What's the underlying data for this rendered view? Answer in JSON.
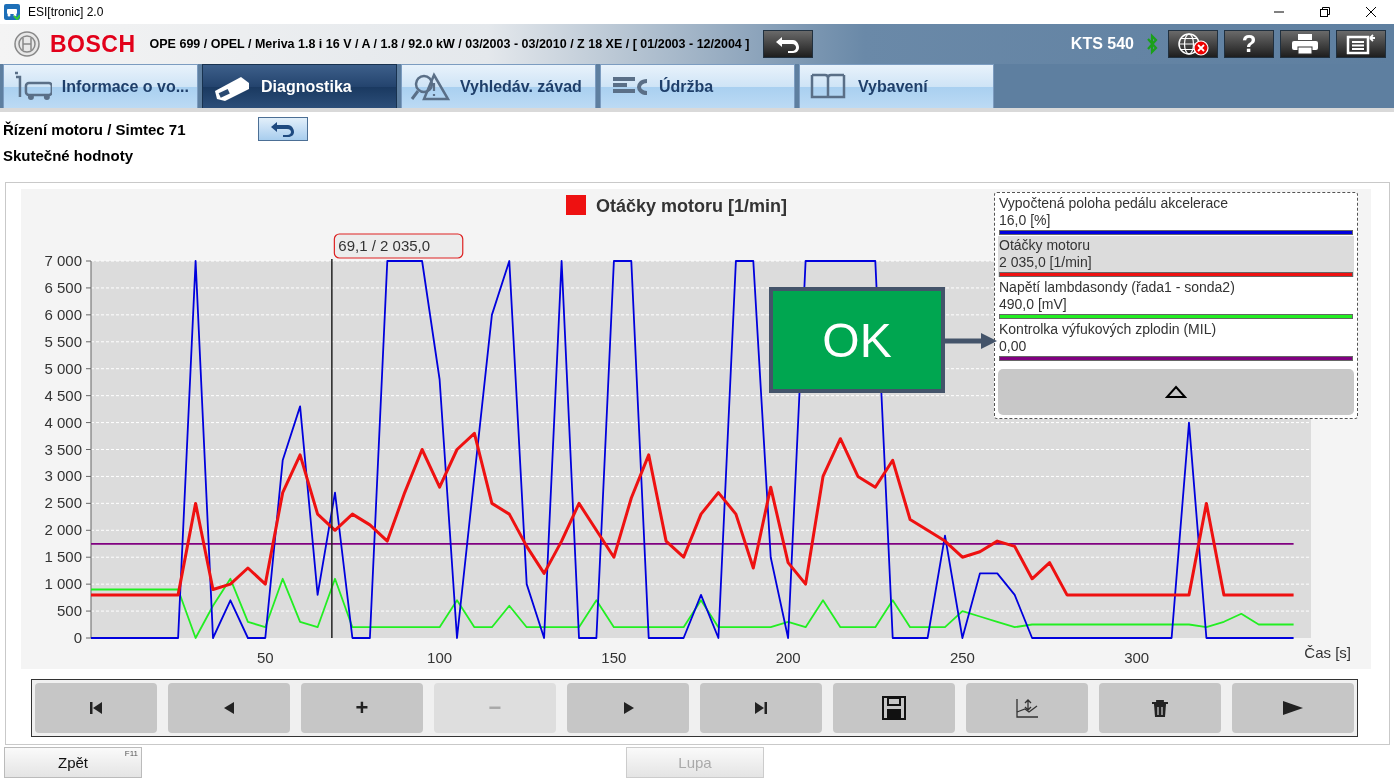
{
  "window": {
    "title": "ESI[tronic] 2.0"
  },
  "header": {
    "brand": "BOSCH",
    "vehicle": "OPE 699 / OPEL / Meriva 1.8 i 16 V / A / 1.8 / 92.0 kW / 03/2003 - 03/2010 / Z 18 XE / [ 01/2003 - 12/2004 ]",
    "device": "KTS 540",
    "help_label": "?"
  },
  "tabs": [
    {
      "label": "Informace o vo...",
      "kind": "vehicle",
      "selected": false
    },
    {
      "label": "Diagnostika",
      "kind": "diagnostics",
      "selected": true
    },
    {
      "label": "Vyhledáv. závad",
      "kind": "search",
      "selected": false
    },
    {
      "label": "Údržba",
      "kind": "service",
      "selected": false
    },
    {
      "label": "Vybavení",
      "kind": "equipment",
      "selected": false
    }
  ],
  "breadcrumb": "Řízení motoru / Simtec 71",
  "subtitle": "Skutečné hodnoty",
  "chart": {
    "chart_data": {
      "type": "line",
      "title": "Otáčky motoru [1/min]",
      "xlabel": "Čas [s]",
      "xlim": [
        0,
        350
      ],
      "ylim": [
        0,
        7000
      ],
      "xticks": [
        50,
        100,
        150,
        200,
        250,
        300
      ],
      "yticks": [
        {
          "value": 0,
          "label": "0"
        },
        {
          "value": 500,
          "label": "500"
        },
        {
          "value": 1000,
          "label": "1 000"
        },
        {
          "value": 1500,
          "label": "1 500"
        },
        {
          "value": 2000,
          "label": "2 000"
        },
        {
          "value": 2500,
          "label": "2 500"
        },
        {
          "value": 3000,
          "label": "3 000"
        },
        {
          "value": 3500,
          "label": "3 500"
        },
        {
          "value": 4000,
          "label": "4 000"
        },
        {
          "value": 4500,
          "label": "4 500"
        },
        {
          "value": 5000,
          "label": "5 000"
        },
        {
          "value": 5500,
          "label": "5 500"
        },
        {
          "value": 6000,
          "label": "6 000"
        },
        {
          "value": 6500,
          "label": "6 500"
        },
        {
          "value": 7000,
          "label": "7 000"
        }
      ],
      "x": [
        0,
        5,
        10,
        15,
        20,
        25,
        30,
        35,
        40,
        45,
        50,
        55,
        60,
        65,
        70,
        75,
        80,
        85,
        90,
        95,
        100,
        105,
        110,
        115,
        120,
        125,
        130,
        135,
        140,
        145,
        150,
        155,
        160,
        165,
        170,
        175,
        180,
        185,
        190,
        195,
        200,
        205,
        210,
        215,
        220,
        225,
        230,
        235,
        240,
        245,
        250,
        255,
        260,
        265,
        270,
        275,
        280,
        285,
        290,
        295,
        300,
        305,
        310,
        315,
        320,
        325,
        330,
        335,
        340,
        345
      ],
      "series": [
        {
          "name": "Vypočtená poloha pedálu akcelerace",
          "color": "#0000dd",
          "values": [
            0,
            0,
            0,
            0,
            0,
            0,
            7000,
            0,
            700,
            0,
            0,
            3300,
            4300,
            800,
            2700,
            0,
            0,
            7000,
            7000,
            7000,
            4800,
            0,
            3000,
            6000,
            7000,
            1000,
            0,
            7000,
            0,
            0,
            7000,
            7000,
            0,
            0,
            0,
            800,
            0,
            7000,
            7000,
            1500,
            0,
            7000,
            7000,
            7000,
            7000,
            7000,
            0,
            0,
            0,
            1900,
            0,
            1200,
            1200,
            800,
            0,
            0,
            0,
            0,
            0,
            0,
            0,
            0,
            0,
            4000,
            0,
            0,
            0,
            0,
            0,
            0
          ]
        },
        {
          "name": "Otáčky motoru",
          "color": "#ee1111",
          "values": [
            800,
            800,
            800,
            800,
            800,
            800,
            2500,
            900,
            1000,
            1300,
            1000,
            2700,
            3400,
            2300,
            2000,
            2300,
            2100,
            1800,
            2700,
            3500,
            2800,
            3500,
            3800,
            2500,
            2300,
            1700,
            1200,
            1800,
            2500,
            2000,
            1500,
            2600,
            3400,
            1800,
            1500,
            2300,
            2700,
            2300,
            1300,
            2800,
            1400,
            1000,
            3000,
            3700,
            3000,
            2800,
            3300,
            2200,
            2000,
            1800,
            1500,
            1600,
            1800,
            1700,
            1100,
            1400,
            800,
            800,
            800,
            800,
            800,
            800,
            800,
            800,
            2500,
            800,
            800,
            800,
            800,
            800
          ]
        },
        {
          "name": "Napětí lambdasondy (řada1 - sonda2)",
          "color": "#22ee22",
          "values": [
            900,
            900,
            900,
            900,
            900,
            900,
            0,
            600,
            1100,
            300,
            200,
            1100,
            300,
            200,
            1100,
            200,
            200,
            200,
            200,
            200,
            200,
            700,
            200,
            200,
            600,
            200,
            200,
            200,
            200,
            700,
            200,
            200,
            200,
            200,
            200,
            700,
            200,
            200,
            200,
            200,
            300,
            200,
            700,
            200,
            200,
            200,
            700,
            200,
            200,
            200,
            500,
            400,
            300,
            200,
            250,
            250,
            250,
            250,
            250,
            250,
            250,
            250,
            250,
            250,
            200,
            300,
            450,
            250,
            250,
            250
          ]
        },
        {
          "name": "Kontrolka výfukových zplodin (MIL)",
          "color": "#800080",
          "values": [
            1750,
            1750,
            1750,
            1750,
            1750,
            1750,
            1750,
            1750,
            1750,
            1750,
            1750,
            1750,
            1750,
            1750,
            1750,
            1750,
            1750,
            1750,
            1750,
            1750,
            1750,
            1750,
            1750,
            1750,
            1750,
            1750,
            1750,
            1750,
            1750,
            1750,
            1750,
            1750,
            1750,
            1750,
            1750,
            1750,
            1750,
            1750,
            1750,
            1750,
            1750,
            1750,
            1750,
            1750,
            1750,
            1750,
            1750,
            1750,
            1750,
            1750,
            1750,
            1750,
            1750,
            1750,
            1750,
            1750,
            1750,
            1750,
            1750,
            1750,
            1750,
            1750,
            1750,
            1750,
            1750,
            1750,
            1750,
            1750,
            1750,
            1750
          ]
        }
      ],
      "grid": true,
      "ref_lines": [
        {
          "axis": "x",
          "value": 69.1
        }
      ],
      "annotations": [
        "69,1 / 2 035,0"
      ]
    }
  },
  "legend": {
    "items": [
      {
        "value": "16,0 [%]",
        "selected": false
      },
      {
        "value": "2 035,0 [1/min]",
        "selected": true
      },
      {
        "value": "490,0 [mV]",
        "selected": false
      },
      {
        "value": "0,00",
        "selected": false
      }
    ]
  },
  "callout": {
    "label": "OK"
  },
  "toolbar": [
    {
      "kind": "first",
      "disabled": false
    },
    {
      "kind": "prev",
      "disabled": false
    },
    {
      "kind": "text",
      "label": "+",
      "disabled": false
    },
    {
      "kind": "text",
      "label": "−",
      "disabled": true
    },
    {
      "kind": "play",
      "disabled": false
    },
    {
      "kind": "last",
      "disabled": false
    },
    {
      "kind": "save",
      "disabled": false
    },
    {
      "kind": "scale",
      "disabled": false
    },
    {
      "kind": "delete",
      "disabled": false
    },
    {
      "kind": "next",
      "disabled": false
    }
  ],
  "footer": [
    {
      "label": "Zpět",
      "key": "F11",
      "disabled": false
    },
    {
      "label": "Lupa",
      "disabled": true
    }
  ]
}
